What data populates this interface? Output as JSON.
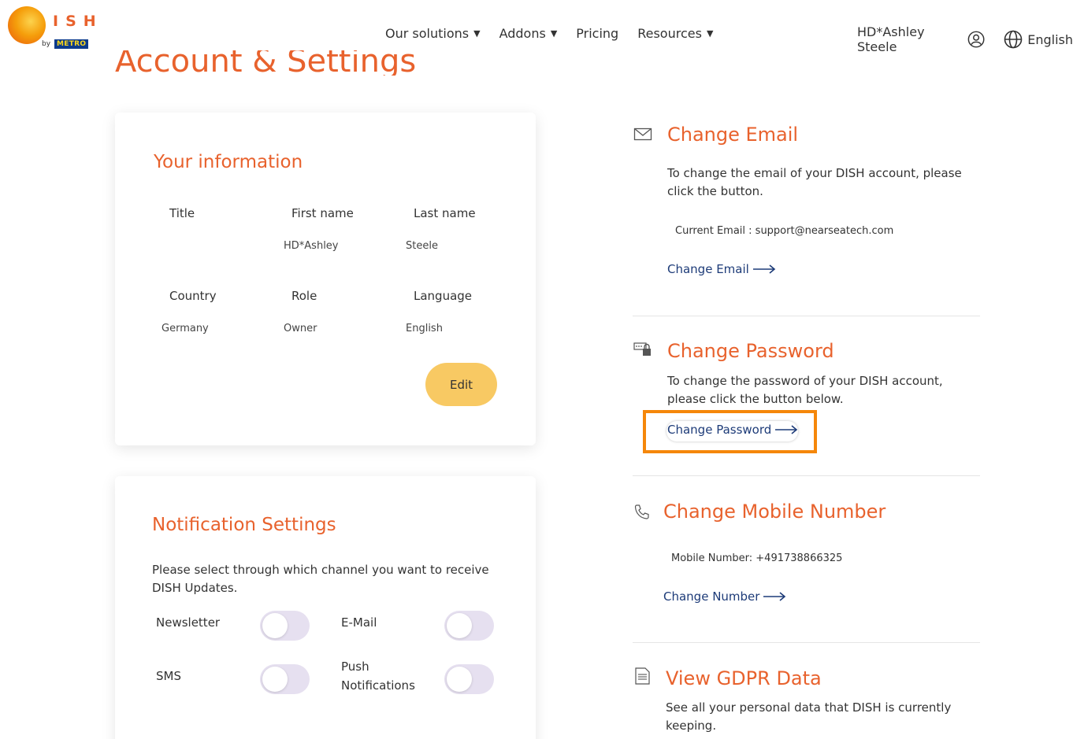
{
  "brand": {
    "logo_text": "ISH",
    "by": "by",
    "metro": "METRO"
  },
  "nav": {
    "items": [
      {
        "label": "Our solutions",
        "caret": "▼"
      },
      {
        "label": "Addons",
        "caret": "▼"
      },
      {
        "label": "Pricing",
        "caret": ""
      },
      {
        "label": "Resources",
        "caret": "▼"
      }
    ],
    "user_name": "HD*Ashley Steele",
    "language": "English"
  },
  "page_title": "Account & Settings",
  "info_card": {
    "title": "Your information",
    "fields": {
      "title_label": "Title",
      "title_value": "",
      "first_name_label": "First name",
      "first_name_value": "HD*Ashley",
      "last_name_label": "Last name",
      "last_name_value": "Steele",
      "country_label": "Country",
      "country_value": "Germany",
      "role_label": "Role",
      "role_value": "Owner",
      "language_label": "Language",
      "language_value": "English"
    },
    "edit_label": "Edit"
  },
  "notification_card": {
    "title": "Notification Settings",
    "description": "Please select through which channel you want to receive DISH Updates.",
    "channels": {
      "newsletter": {
        "label": "Newsletter",
        "enabled": false
      },
      "email": {
        "label": "E-Mail",
        "enabled": false
      },
      "sms": {
        "label": "SMS",
        "enabled": false
      },
      "push_line1": "Push",
      "push_line2": "Notifications",
      "push": {
        "enabled": false
      }
    }
  },
  "change_email": {
    "title": "Change Email",
    "text": "To change the email of your DISH account, please click the button.",
    "current": "Current Email : support@nearseatech.com",
    "link": "Change Email"
  },
  "change_password": {
    "title": "Change Password",
    "text": "To change the password of your DISH account, please click the button below.",
    "link": "Change Password"
  },
  "change_mobile": {
    "title": "Change Mobile Number",
    "current": "Mobile Number: +491738866325",
    "link": "Change Number"
  },
  "gdpr": {
    "title": "View GDPR Data",
    "text": "See all your personal data that DISH is currently keeping."
  },
  "colors": {
    "accent": "#e8622d",
    "link": "#1d3b78",
    "edit_button": "#f8c963",
    "highlight": "#f5870a"
  }
}
